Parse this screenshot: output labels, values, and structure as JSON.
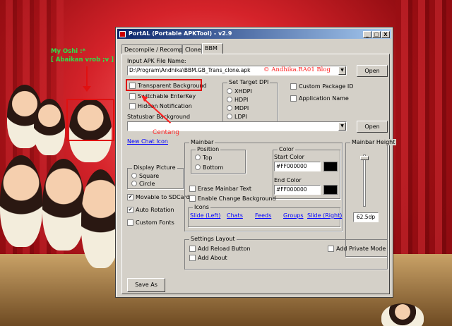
{
  "annotations": {
    "oshi": "My Oshi :*",
    "ignore": "[ Abaikan vrob ;v ]",
    "centang": "Centang",
    "watermark": "© Andhika.RA01 Blog"
  },
  "window": {
    "title": "PortAL (Portable APKTool) - v2.9",
    "controls": [
      "_",
      "□",
      "X"
    ]
  },
  "tabs": [
    "Decompile / Recompile",
    "Clone",
    "BBM"
  ],
  "active_tab": "BBM",
  "form": {
    "input_label": "Input APK File Name:",
    "input_value": "D:\\Program\\Andhika\\BBM.GB_Trans_clone.apk",
    "open_label": "Open",
    "transparent_bg": "Transparent Background",
    "switchable_enterkey": "Switchable EnterKey",
    "hidden_notification": "Hidden Notification",
    "statusbar_label": "Statusbar Background",
    "statusbar_open_label": "Open",
    "new_chat_icon": "New Chat Icon",
    "target_dpi_title": "Set Target DPI",
    "dpi_options": [
      "XHDPI",
      "HDPI",
      "MDPI",
      "LDPI"
    ],
    "custom_package": "Custom Package ID",
    "application_name": "Application Name",
    "display_picture_title": "Display Picture",
    "dp_options": [
      "Square",
      "Circle"
    ],
    "movable_sdcard": "Movable to SDCard",
    "auto_rotation": "Auto Rotation",
    "custom_fonts": "Custom Fonts",
    "save_as": "Save As"
  },
  "mainbar": {
    "title": "Mainbar",
    "position_title": "Position",
    "positions": [
      "Top",
      "Bottom"
    ],
    "color_title": "Color",
    "start_color_label": "Start Color",
    "start_color_value": "#FF000000",
    "end_color_label": "End Color",
    "end_color_value": "#FF000000",
    "erase_text": "Erase Mainbar Text",
    "enable_bg": "Enable Change Background",
    "icons_title": "Icons",
    "icon_links": [
      "Slide (Left)",
      "Chats",
      "Feeds",
      "Groups",
      "Slide (Right)"
    ],
    "height_title": "Mainbar Height",
    "height_value": "62.5dp"
  },
  "settings_layout": {
    "title": "Settings Layout",
    "add_reload": "Add Reload Button",
    "add_about": "Add About",
    "add_private": "Add Private Mode"
  },
  "state": {
    "movable_checked": true,
    "autorotation_checked": true
  },
  "colors": {
    "annotation_green": "#2fe04a",
    "annotation_red": "#e01010",
    "titlebar_start": "#0a246a",
    "link_blue": "#0000ff"
  }
}
